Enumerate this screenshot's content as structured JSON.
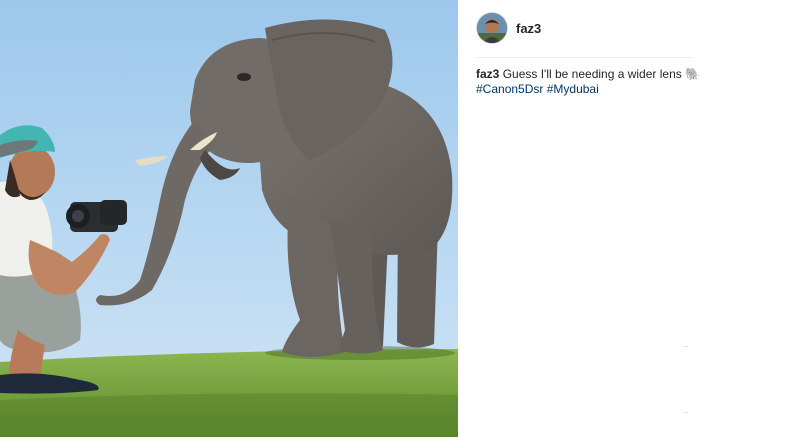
{
  "post": {
    "username": "faz3",
    "caption": {
      "username": "faz3",
      "text": "Guess I'll be needing a wider lens",
      "emoji": "🐘",
      "hashtags": [
        "#Canon5Dsr",
        "#Mydubai"
      ]
    }
  },
  "icons": {
    "avatar": "avatar",
    "elephant_emoji": "elephant-emoji-icon"
  },
  "colors": {
    "hashtag": "#00376b",
    "text": "#262626",
    "sky": "#a8cfee",
    "grass": "#6f9a3a"
  }
}
